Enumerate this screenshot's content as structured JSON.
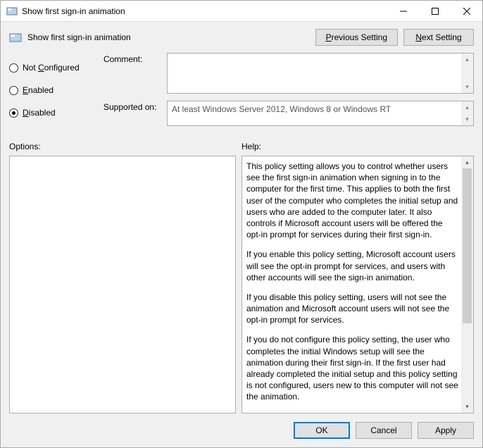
{
  "window": {
    "title": "Show first sign-in animation"
  },
  "header": {
    "policy_name": "Show first sign-in animation",
    "prev_btn": "Previous Setting",
    "next_btn": "Next Setting"
  },
  "settings": {
    "not_configured_label": "Not Configured",
    "enabled_label": "Enabled",
    "disabled_label": "Disabled",
    "selected": "disabled",
    "comment_label": "Comment:",
    "comment_value": "",
    "supported_label": "Supported on:",
    "supported_value": "At least Windows Server 2012, Windows 8 or Windows RT"
  },
  "panels": {
    "options_label": "Options:",
    "help_label": "Help:",
    "help_p1": "This policy setting allows you to control whether users see the first sign-in animation when signing in to the computer for the first time.  This applies to both the first user of the computer who completes the initial setup and users who are added to the computer later.  It also controls if Microsoft account users will be offered the opt-in prompt for services during their first sign-in.",
    "help_p2": "If you enable this policy setting, Microsoft account users will see the opt-in prompt for services, and users with other accounts will see the sign-in animation.",
    "help_p3": "If you disable this policy setting, users will not see the animation and Microsoft account users will not see the opt-in prompt for services.",
    "help_p4": "If you do not configure this policy setting, the user who completes the initial Windows setup will see the animation during their first sign-in. If the first user had already completed the initial setup and this policy setting is not configured, users new to this computer will not see the animation."
  },
  "footer": {
    "ok": "OK",
    "cancel": "Cancel",
    "apply": "Apply"
  }
}
